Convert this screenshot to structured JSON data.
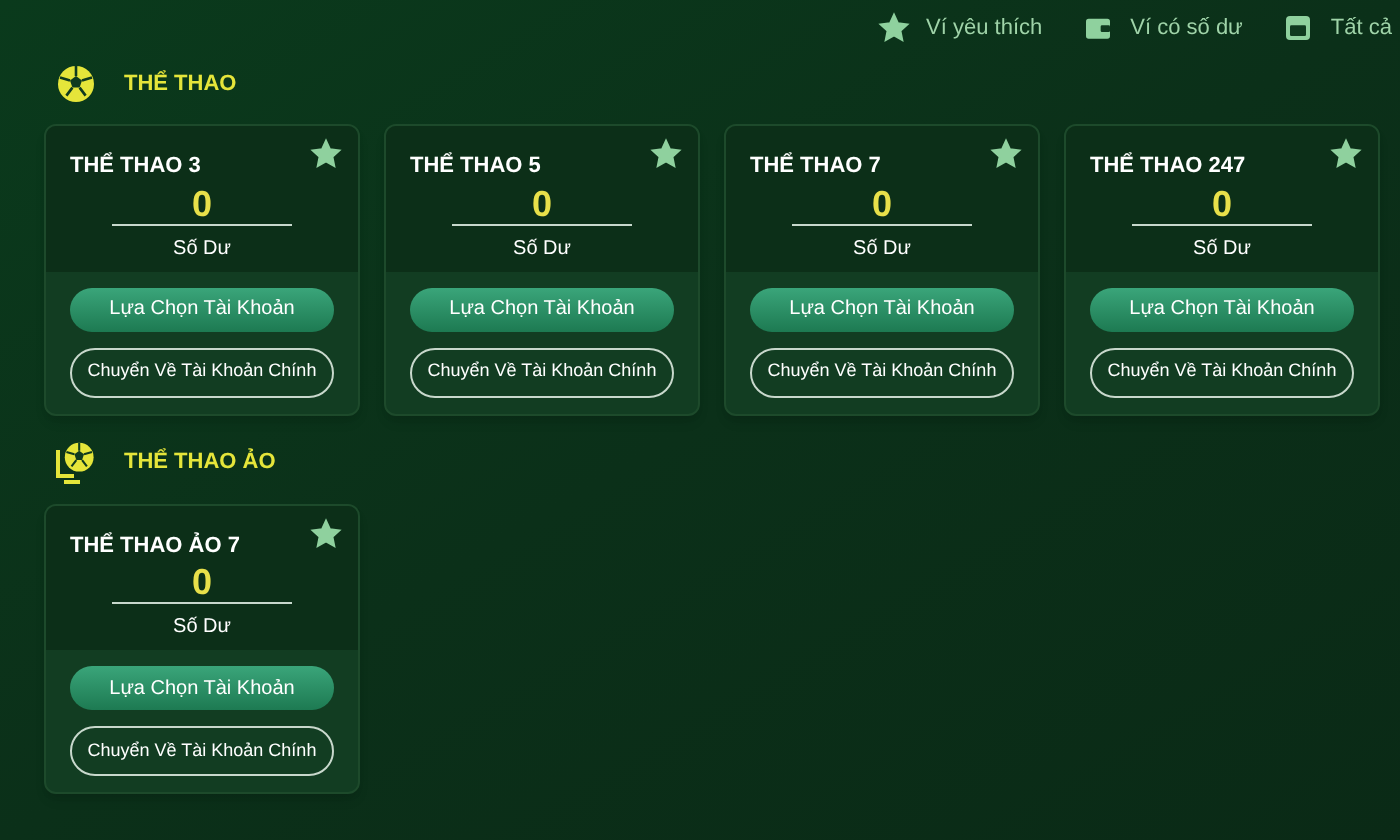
{
  "filters": [
    {
      "label": "Ví yêu thích",
      "kind": "star"
    },
    {
      "label": "Ví có số dư",
      "kind": "wallet"
    },
    {
      "label": "Tất cả",
      "kind": "box"
    }
  ],
  "sections": [
    {
      "title": "THỂ THAO",
      "kind": "ball",
      "wallets": [
        {
          "name": "THỂ THAO 3",
          "balance": "0",
          "balance_label": "Số Dư",
          "favorite": true,
          "select_button": "Lựa Chọn Tài Khoản",
          "transfer_button": "Chuyển Về Tài Khoản Chính"
        },
        {
          "name": "THỂ THAO 5",
          "balance": "0",
          "balance_label": "Số Dư",
          "favorite": true,
          "select_button": "Lựa Chọn Tài Khoản",
          "transfer_button": "Chuyển Về Tài Khoản Chính"
        },
        {
          "name": "THỂ THAO 7",
          "balance": "0",
          "balance_label": "Số Dư",
          "favorite": true,
          "select_button": "Lựa Chọn Tài Khoản",
          "transfer_button": "Chuyển Về Tài Khoản Chính"
        },
        {
          "name": "THỂ THAO 247",
          "balance": "0",
          "balance_label": "Số Dư",
          "favorite": true,
          "select_button": "Lựa Chọn Tài Khoản",
          "transfer_button": "Chuyển Về Tài Khoản Chính"
        }
      ]
    },
    {
      "title": "THỂ THAO ẢO",
      "kind": "monitor-ball",
      "wallets": [
        {
          "name": "THỂ THAO ẢO 7",
          "balance": "0",
          "balance_label": "Số Dư",
          "favorite": true,
          "select_button": "Lựa Chọn Tài Khoản",
          "transfer_button": "Chuyển Về Tài Khoản Chính"
        }
      ]
    }
  ]
}
